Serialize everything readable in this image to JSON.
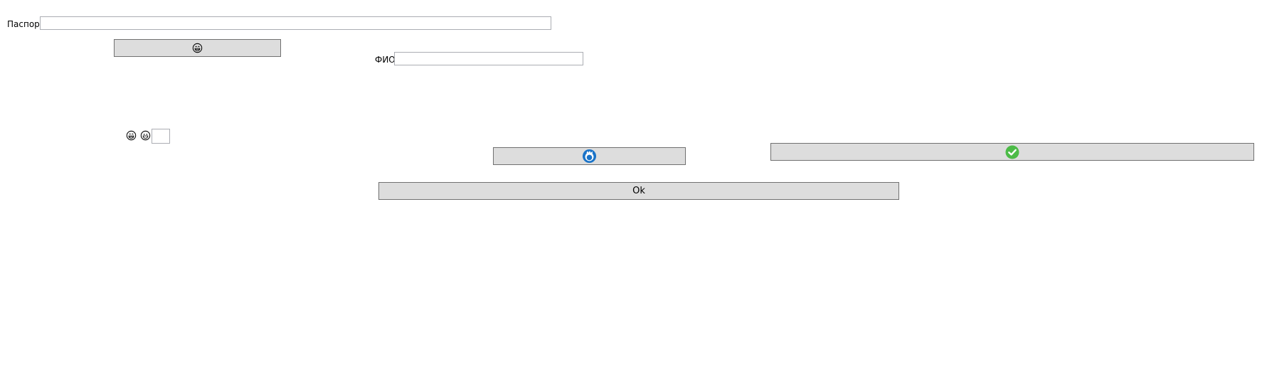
{
  "form": {
    "passport_label": "Паспорт",
    "passport_value": "",
    "fio_label": "ФИО",
    "fio_value": "",
    "small_field_value": "",
    "ok_button_label": "Ok"
  },
  "icons": {
    "top_button_icon": "grinning-face-outline-icon",
    "small_emoji_1": "grinning-face-outline-icon",
    "small_emoji_2": "smiling-face-outline-icon",
    "middle_button_icon": "blue-round-logo-icon",
    "check_button_icon": "green-check-circle-icon"
  },
  "colors": {
    "button_bg": "#dddddd",
    "button_border": "#707070",
    "field_border": "#abadb3",
    "check_green": "#4cbb47",
    "logo_blue": "#1a73c8"
  }
}
